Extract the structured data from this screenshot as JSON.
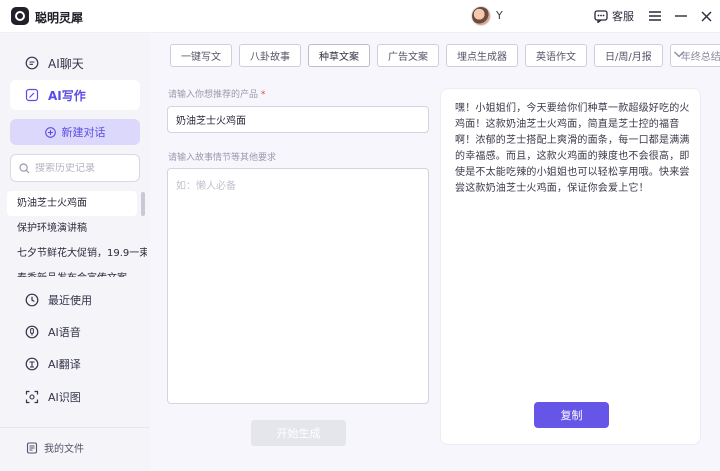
{
  "app": {
    "title": "聪明灵犀"
  },
  "user": {
    "name": "Y"
  },
  "header": {
    "support_label": "客服"
  },
  "sidebar": {
    "nav": [
      {
        "label": "AI聊天",
        "icon": "chat-bubble-icon"
      },
      {
        "label": "AI写作",
        "icon": "write-icon"
      }
    ],
    "new_chat_label": "新建对话",
    "search_placeholder": "搜索历史记录",
    "history": [
      "奶油芝士火鸡面",
      "保护环境演讲稿",
      "七夕节鲜花大促销，19.9一束",
      "春季新品发布会宣传文案"
    ],
    "tools": [
      {
        "label": "最近使用",
        "icon": "clock-icon"
      },
      {
        "label": "AI语音",
        "icon": "voice-icon"
      },
      {
        "label": "AI翻译",
        "icon": "translate-icon"
      },
      {
        "label": "AI识图",
        "icon": "image-recognition-icon"
      }
    ],
    "my_files_label": "我的文件"
  },
  "tabs": [
    {
      "label": "一键写文"
    },
    {
      "label": "八卦故事"
    },
    {
      "label": "种草文案"
    },
    {
      "label": "广告文案"
    },
    {
      "label": "埋点生成器"
    },
    {
      "label": "英语作文"
    },
    {
      "label": "日/周/月报"
    },
    {
      "label": "年终总结"
    }
  ],
  "form": {
    "product_label": "请输入你想推荐的产品",
    "required_mark": "*",
    "product_value": "奶油芝士火鸡面",
    "detail_label": "请输入故事情节等其他要求",
    "detail_placeholder": "如：懒人必备",
    "generate_label": "开始生成"
  },
  "result": {
    "text": "嘿！小姐姐们，今天要给你们种草一款超级好吃的火鸡面！这款奶油芝士火鸡面，简直是芝士控的福音啊！浓郁的芝士搭配上爽滑的面条，每一口都是满满的幸福感。而且，这款火鸡面的辣度也不会很高，即使是不太能吃辣的小姐姐也可以轻松享用哦。快来尝尝这款奶油芝士火鸡面，保证你会爱上它！",
    "copy_label": "复制"
  },
  "colors": {
    "accent": "#6556e8",
    "accent_light": "#dcd8fb"
  }
}
